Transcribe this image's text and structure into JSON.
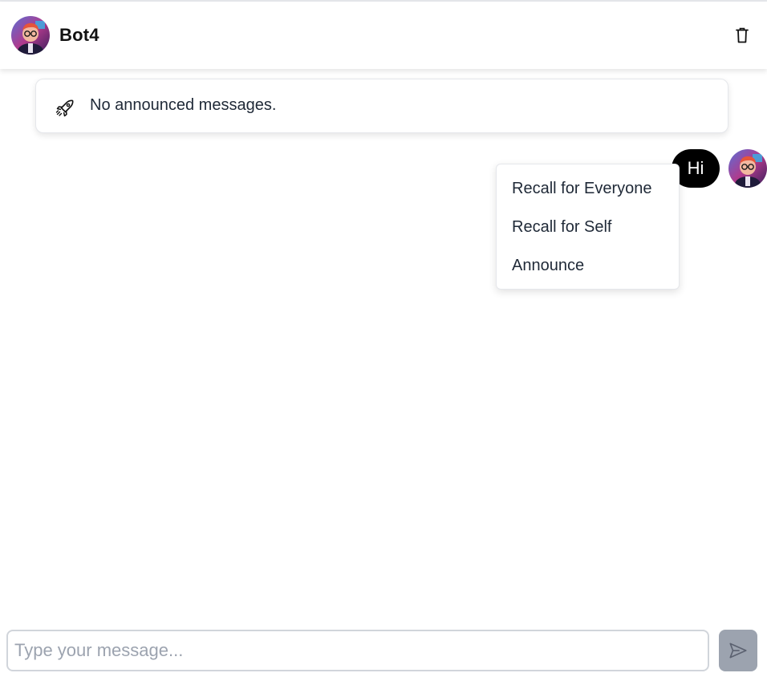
{
  "header": {
    "title": "Bot4",
    "avatar_icon": "user-avatar-icon",
    "delete_icon": "trash-icon"
  },
  "announcement": {
    "icon": "rocket-icon",
    "text": "No announced messages."
  },
  "messages": [
    {
      "text": "Hi",
      "sender": "self"
    }
  ],
  "context_menu": {
    "items": [
      {
        "label": "Recall for Everyone"
      },
      {
        "label": "Recall for Self"
      },
      {
        "label": "Announce"
      }
    ]
  },
  "composer": {
    "placeholder": "Type your message...",
    "value": "",
    "send_icon": "send-icon"
  },
  "colors": {
    "bubble": "#000000",
    "send_button": "#9ca3af",
    "border": "#e5e7eb"
  }
}
